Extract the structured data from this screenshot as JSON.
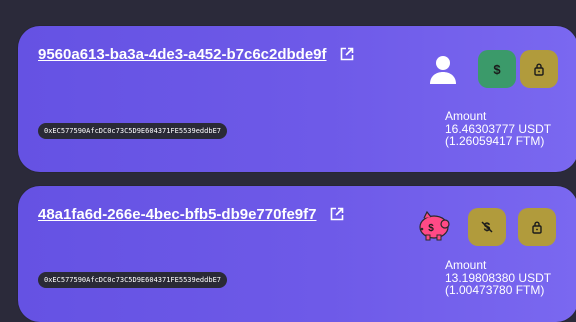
{
  "cards": [
    {
      "title": "9560a613-ba3a-4de3-a452-b7c6c2dbde9f",
      "address": "0xEC577590AfcDC0c73C5D9E604371FE5539eddbE7",
      "avatar_icon": "user-icon",
      "buttons": [
        {
          "icon": "dollar-icon",
          "color": "#3b9a6a"
        },
        {
          "icon": "lock-icon",
          "color": "#b19b3c"
        }
      ],
      "amount_label": "Amount",
      "amount_usdt": "16.46303777 USDT",
      "amount_ftm": "(1.26059417 FTM)"
    },
    {
      "title": "48a1fa6d-266e-4bec-bfb5-db9e770fe9f7",
      "address": "0xEC577590AfcDC0c73C5D9E604371FE5539eddbE7",
      "avatar_icon": "piggy-bank-icon",
      "buttons": [
        {
          "icon": "dollar-off-icon",
          "color": "#b19b3c"
        },
        {
          "icon": "lock-icon",
          "color": "#b19b3c"
        }
      ],
      "amount_label": "Amount",
      "amount_usdt": "13.19808380 USDT",
      "amount_ftm": "(1.00473780 FTM)"
    }
  ]
}
